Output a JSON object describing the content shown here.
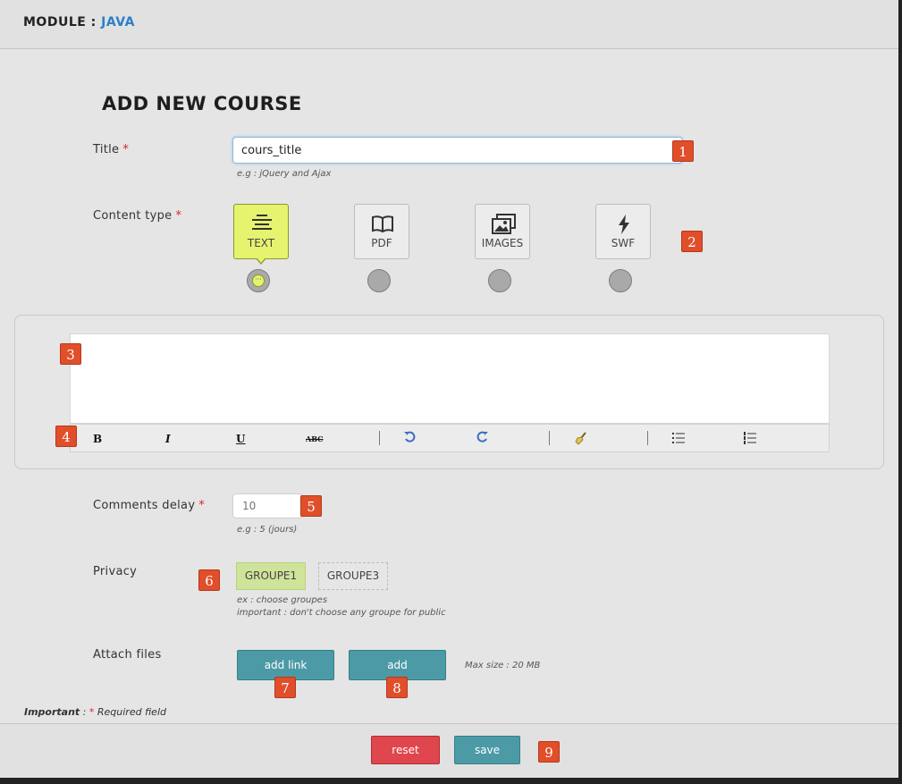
{
  "header": {
    "module_label": "MODULE :",
    "module_value": "JAVA"
  },
  "page_title": "ADD NEW COURSE",
  "title_field": {
    "label": "Title",
    "required_mark": "*",
    "value": "cours_title",
    "hint": "e.g : jQuery and Ajax"
  },
  "content_type": {
    "label": "Content type",
    "required_mark": "*",
    "selected": "TEXT",
    "options": [
      {
        "label": "TEXT",
        "icon": "text-lines-icon"
      },
      {
        "label": "PDF",
        "icon": "book-icon"
      },
      {
        "label": "IMAGES",
        "icon": "images-icon"
      },
      {
        "label": "SWF",
        "icon": "lightning-icon"
      }
    ]
  },
  "editor": {
    "toolbar": {
      "bold": "B",
      "italic": "I",
      "underline": "U",
      "strike": "ABC"
    }
  },
  "comments_delay": {
    "label": "Comments delay",
    "required_mark": "*",
    "placeholder": "10",
    "hint": "e.g : 5 (jours)"
  },
  "privacy": {
    "label": "Privacy",
    "groups": [
      {
        "label": "GROUPE1",
        "selected": true
      },
      {
        "label": "GROUPE3",
        "selected": false
      }
    ],
    "hint1": "ex : choose groupes",
    "hint2": "important : don't choose any groupe for public"
  },
  "attach": {
    "label": "Attach files",
    "add_link": "add link",
    "add": "add",
    "max_size": "Max size : 20 MB"
  },
  "important_note": {
    "label": "Important",
    "sep": " : ",
    "mark": "*",
    "text": " Required field"
  },
  "footer": {
    "reset": "reset",
    "save": "save"
  },
  "badges": [
    "1",
    "2",
    "3",
    "4",
    "5",
    "6",
    "7",
    "8",
    "9"
  ],
  "colors": {
    "accent": "#2a7fc9",
    "badge": "#e04e2a",
    "selected": "#e5f36f",
    "teal": "#4c9aa6",
    "reset": "#e0464d"
  }
}
